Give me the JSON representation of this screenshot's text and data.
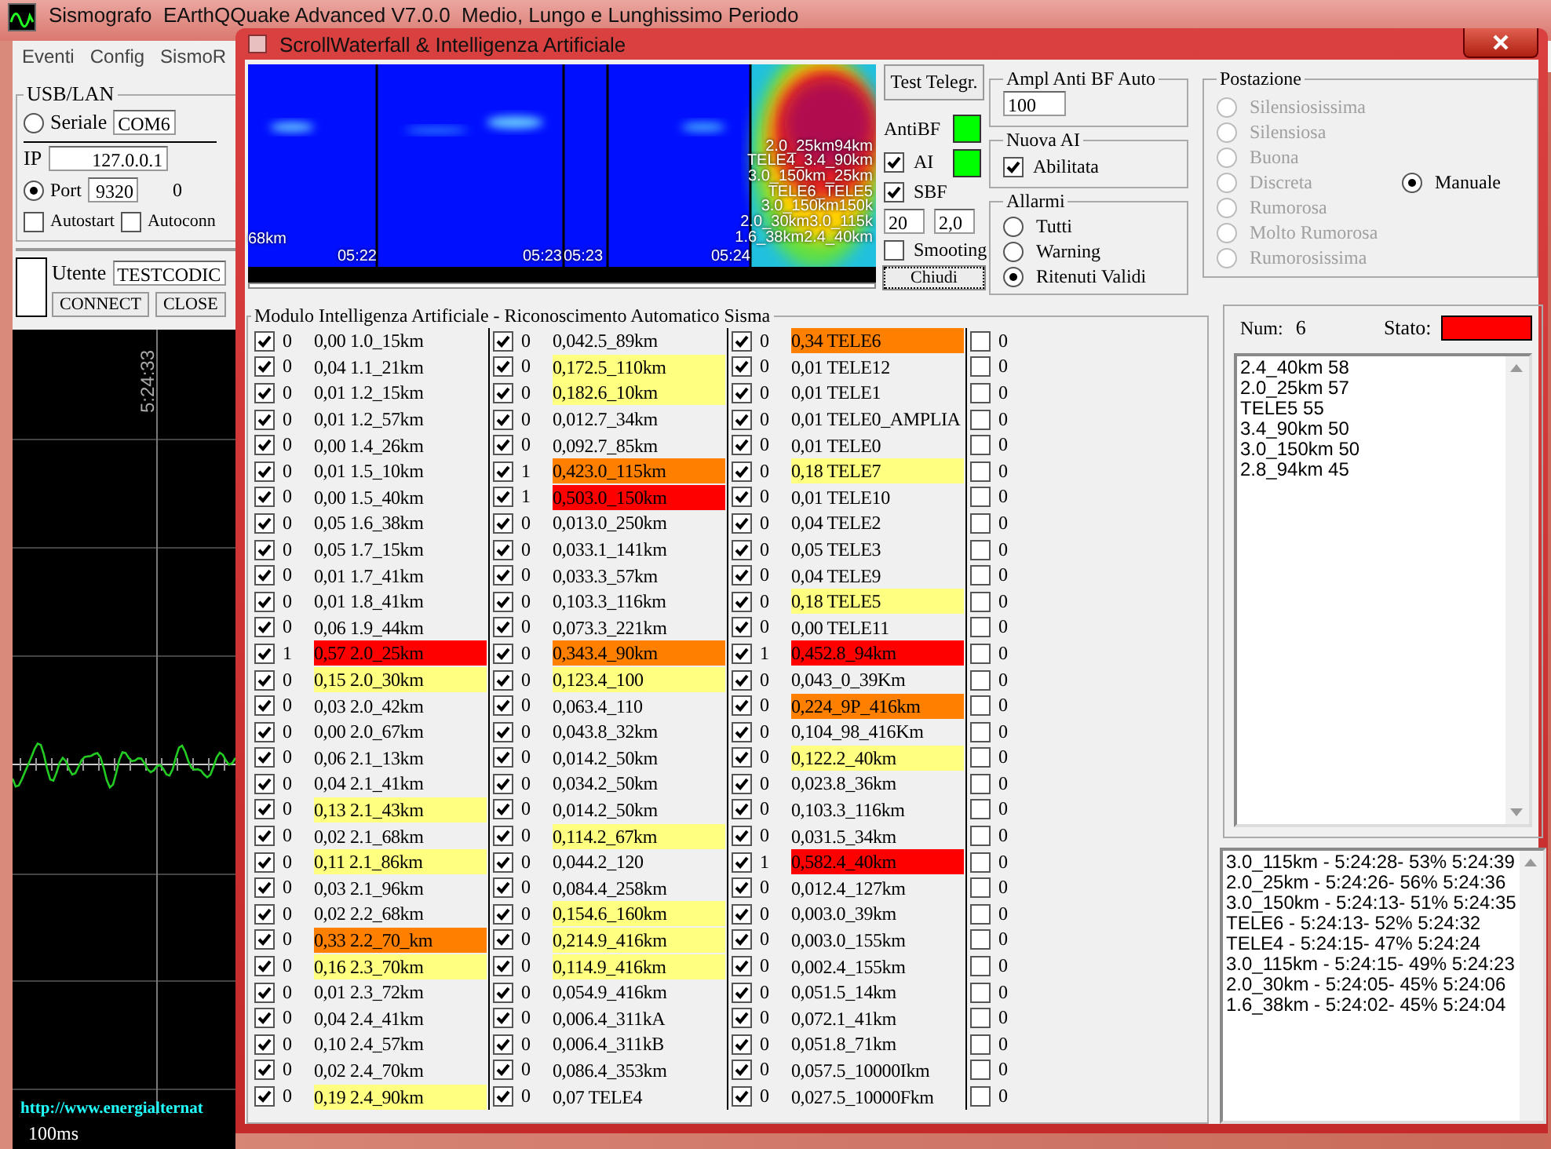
{
  "main_window": {
    "title": "Sismografo  EArthQQuake Advanced V7.0.0  Medio, Lungo e Lunghissimo Periodo",
    "menu": [
      "Eventi",
      "Config",
      "SismoR"
    ],
    "connection": {
      "title": "USB/LAN",
      "serial": {
        "label": "Seriale",
        "selected": false,
        "value": "COM6"
      },
      "ip": {
        "label": "IP",
        "value": "127.0.0.1"
      },
      "port": {
        "label": "Port",
        "selected": true,
        "value": "9320"
      },
      "port_status": "0",
      "autostart": {
        "label": "Autostart",
        "checked": false
      },
      "autoconn": {
        "label": "Autoconn",
        "checked": false
      }
    },
    "user": {
      "label": "Utente",
      "value": "TESTCODIC",
      "buttons": [
        "CONNECT",
        "CLOSE"
      ]
    },
    "scope": {
      "time": "5:24:33",
      "link": "http://www.energialternat",
      "scale": "100ms"
    }
  },
  "dialog": {
    "title": "ScrollWaterfall & Intelligenza Artificiale",
    "waterfall": {
      "distance": "68km",
      "times": [
        "05:22",
        "05:23",
        "05:23",
        "05:24"
      ],
      "labels": [
        "2.0_25km94km",
        "TELE4_3.4_90km",
        "3.0_150km_25km",
        "TELE6_TELE5",
        "3.0_150km150k",
        "2.0_30km3.0_115k",
        "1.6_38km2.4_40km"
      ]
    },
    "test_button": "Test Telegr.",
    "antibf": {
      "label": "AntiBF",
      "on": true
    },
    "ai": {
      "label": "AI",
      "checked": true,
      "on": true
    },
    "sbf": {
      "label": "SBF",
      "checked": true,
      "fields": [
        "20",
        "2,0"
      ]
    },
    "smoothing": {
      "label": "Smooting",
      "checked": false
    },
    "close_button": "Chiudi",
    "ampl": {
      "title": "Ampl Anti BF Auto",
      "value": "100"
    },
    "nuova_ai": {
      "title": "Nuova AI",
      "label": "Abilitata",
      "checked": true
    },
    "allarmi": {
      "title": "Allarmi",
      "options": [
        {
          "label": "Tutti",
          "selected": false
        },
        {
          "label": "Warning",
          "selected": false
        },
        {
          "label": "Ritenuti Validi",
          "selected": true
        }
      ]
    },
    "postazione": {
      "title": "Postazione",
      "options": [
        {
          "label": "Silensiosissima",
          "selected": false,
          "disabled": true
        },
        {
          "label": "Silensiosa",
          "selected": false,
          "disabled": true
        },
        {
          "label": "Buona",
          "selected": false,
          "disabled": true
        },
        {
          "label": "Discreta",
          "selected": false,
          "disabled": true
        },
        {
          "label": "Rumorosa",
          "selected": false,
          "disabled": true
        },
        {
          "label": "Molto Rumorosa",
          "selected": false,
          "disabled": true
        },
        {
          "label": "Rumorosissima",
          "selected": false,
          "disabled": true
        },
        {
          "label": "Manuale",
          "selected": true,
          "disabled": false
        }
      ]
    },
    "ai_module": {
      "title": "Modulo Intelligenza Artificiale - Riconoscimento Automatico Sisma",
      "columns": [
        {
          "rows": [
            {
              "checked": true,
              "count": "0",
              "label": "0,00 1.0_15km"
            },
            {
              "checked": true,
              "count": "0",
              "label": "0,04 1.1_21km"
            },
            {
              "checked": true,
              "count": "0",
              "label": "0,01 1.2_15km"
            },
            {
              "checked": true,
              "count": "0",
              "label": "0,01 1.2_57km"
            },
            {
              "checked": true,
              "count": "0",
              "label": "0,00 1.4_26km"
            },
            {
              "checked": true,
              "count": "0",
              "label": "0,01 1.5_10km"
            },
            {
              "checked": true,
              "count": "0",
              "label": "0,00 1.5_40km"
            },
            {
              "checked": true,
              "count": "0",
              "label": "0,05 1.6_38km"
            },
            {
              "checked": true,
              "count": "0",
              "label": "0,05 1.7_15km"
            },
            {
              "checked": true,
              "count": "0",
              "label": "0,01 1.7_41km"
            },
            {
              "checked": true,
              "count": "0",
              "label": "0,01 1.8_41km"
            },
            {
              "checked": true,
              "count": "0",
              "label": "0,06 1.9_44km"
            },
            {
              "checked": true,
              "count": "1",
              "label": "0,57 2.0_25km",
              "color": "#ff0000"
            },
            {
              "checked": true,
              "count": "0",
              "label": "0,15 2.0_30km",
              "color": "#ffff80"
            },
            {
              "checked": true,
              "count": "0",
              "label": "0,03 2.0_42km"
            },
            {
              "checked": true,
              "count": "0",
              "label": "0,00 2.0_67km"
            },
            {
              "checked": true,
              "count": "0",
              "label": "0,06 2.1_13km"
            },
            {
              "checked": true,
              "count": "0",
              "label": "0,04 2.1_41km"
            },
            {
              "checked": true,
              "count": "0",
              "label": "0,13 2.1_43km",
              "color": "#ffff80"
            },
            {
              "checked": true,
              "count": "0",
              "label": "0,02 2.1_68km"
            },
            {
              "checked": true,
              "count": "0",
              "label": "0,11 2.1_86km",
              "color": "#ffff80"
            },
            {
              "checked": true,
              "count": "0",
              "label": "0,03 2.1_96km"
            },
            {
              "checked": true,
              "count": "0",
              "label": "0,02 2.2_68km"
            },
            {
              "checked": true,
              "count": "0",
              "label": "0,33 2.2_70_km",
              "color": "#ff8000"
            },
            {
              "checked": true,
              "count": "0",
              "label": "0,16 2.3_70km",
              "color": "#ffff80"
            },
            {
              "checked": true,
              "count": "0",
              "label": "0,01 2.3_72km"
            },
            {
              "checked": true,
              "count": "0",
              "label": "0,04 2.4_41km"
            },
            {
              "checked": true,
              "count": "0",
              "label": "0,10 2.4_57km"
            },
            {
              "checked": true,
              "count": "0",
              "label": "0,02 2.4_70km"
            },
            {
              "checked": true,
              "count": "0",
              "label": "0,19 2.4_90km",
              "color": "#ffff80"
            }
          ]
        },
        {
          "rows": [
            {
              "checked": true,
              "count": "0",
              "label": "0,042.5_89km"
            },
            {
              "checked": true,
              "count": "0",
              "label": "0,172.5_110km",
              "color": "#ffff80"
            },
            {
              "checked": true,
              "count": "0",
              "label": "0,182.6_10km",
              "color": "#ffff80"
            },
            {
              "checked": true,
              "count": "0",
              "label": "0,012.7_34km"
            },
            {
              "checked": true,
              "count": "0",
              "label": "0,092.7_85km"
            },
            {
              "checked": true,
              "count": "1",
              "label": "0,423.0_115km",
              "color": "#ff8000"
            },
            {
              "checked": true,
              "count": "1",
              "label": "0,503.0_150km",
              "color": "#ff0000"
            },
            {
              "checked": true,
              "count": "0",
              "label": "0,013.0_250km"
            },
            {
              "checked": true,
              "count": "0",
              "label": "0,033.1_141km"
            },
            {
              "checked": true,
              "count": "0",
              "label": "0,033.3_57km"
            },
            {
              "checked": true,
              "count": "0",
              "label": "0,103.3_116km"
            },
            {
              "checked": true,
              "count": "0",
              "label": "0,073.3_221km"
            },
            {
              "checked": true,
              "count": "0",
              "label": "0,343.4_90km",
              "color": "#ff8000"
            },
            {
              "checked": true,
              "count": "0",
              "label": "0,123.4_100",
              "color": "#ffff80"
            },
            {
              "checked": true,
              "count": "0",
              "label": "0,063.4_110"
            },
            {
              "checked": true,
              "count": "0",
              "label": "0,043.8_32km"
            },
            {
              "checked": true,
              "count": "0",
              "label": "0,014.2_50km"
            },
            {
              "checked": true,
              "count": "0",
              "label": "0,034.2_50km"
            },
            {
              "checked": true,
              "count": "0",
              "label": "0,014.2_50km"
            },
            {
              "checked": true,
              "count": "0",
              "label": "0,114.2_67km",
              "color": "#ffff80"
            },
            {
              "checked": true,
              "count": "0",
              "label": "0,044.2_120"
            },
            {
              "checked": true,
              "count": "0",
              "label": "0,084.4_258km"
            },
            {
              "checked": true,
              "count": "0",
              "label": "0,154.6_160km",
              "color": "#ffff80"
            },
            {
              "checked": true,
              "count": "0",
              "label": "0,214.9_416km",
              "color": "#ffff80"
            },
            {
              "checked": true,
              "count": "0",
              "label": "0,114.9_416km",
              "color": "#ffff80"
            },
            {
              "checked": true,
              "count": "0",
              "label": "0,054.9_416km"
            },
            {
              "checked": true,
              "count": "0",
              "label": "0,006.4_311kA"
            },
            {
              "checked": true,
              "count": "0",
              "label": "0,006.4_311kB"
            },
            {
              "checked": true,
              "count": "0",
              "label": "0,086.4_353km"
            },
            {
              "checked": true,
              "count": "0",
              "label": "0,07 TELE4"
            }
          ]
        },
        {
          "rows": [
            {
              "checked": true,
              "count": "0",
              "label": "0,34 TELE6",
              "color": "#ff8000"
            },
            {
              "checked": true,
              "count": "0",
              "label": "0,01 TELE12"
            },
            {
              "checked": true,
              "count": "0",
              "label": "0,01 TELE1"
            },
            {
              "checked": true,
              "count": "0",
              "label": "0,01 TELE0_AMPLIA"
            },
            {
              "checked": true,
              "count": "0",
              "label": "0,01 TELE0"
            },
            {
              "checked": true,
              "count": "0",
              "label": "0,18 TELE7",
              "color": "#ffff80"
            },
            {
              "checked": true,
              "count": "0",
              "label": "0,01 TELE10"
            },
            {
              "checked": true,
              "count": "0",
              "label": "0,04 TELE2"
            },
            {
              "checked": true,
              "count": "0",
              "label": "0,05 TELE3"
            },
            {
              "checked": true,
              "count": "0",
              "label": "0,04 TELE9"
            },
            {
              "checked": true,
              "count": "0",
              "label": "0,18 TELE5",
              "color": "#ffff80"
            },
            {
              "checked": true,
              "count": "0",
              "label": "0,00 TELE11"
            },
            {
              "checked": true,
              "count": "1",
              "label": "0,452.8_94km",
              "color": "#ff0000"
            },
            {
              "checked": true,
              "count": "0",
              "label": "0,043_0_39Km"
            },
            {
              "checked": true,
              "count": "0",
              "label": "0,224_9P_416km",
              "color": "#ff8000"
            },
            {
              "checked": true,
              "count": "0",
              "label": "0,104_98_416Km"
            },
            {
              "checked": true,
              "count": "0",
              "label": "0,122.2_40km",
              "color": "#ffff80"
            },
            {
              "checked": true,
              "count": "0",
              "label": "0,023.8_36km"
            },
            {
              "checked": true,
              "count": "0",
              "label": "0,103.3_116km"
            },
            {
              "checked": true,
              "count": "0",
              "label": "0,031.5_34km"
            },
            {
              "checked": true,
              "count": "1",
              "label": "0,582.4_40km",
              "color": "#ff0000"
            },
            {
              "checked": true,
              "count": "0",
              "label": "0,012.4_127km"
            },
            {
              "checked": true,
              "count": "0",
              "label": "0,003.0_39km"
            },
            {
              "checked": true,
              "count": "0",
              "label": "0,003.0_155km"
            },
            {
              "checked": true,
              "count": "0",
              "label": "0,002.4_155km"
            },
            {
              "checked": true,
              "count": "0",
              "label": "0,051.5_14km"
            },
            {
              "checked": true,
              "count": "0",
              "label": "0,072.1_41km"
            },
            {
              "checked": true,
              "count": "0",
              "label": "0,051.8_71km"
            },
            {
              "checked": true,
              "count": "0",
              "label": "0,057.5_10000Ikm"
            },
            {
              "checked": true,
              "count": "0",
              "label": "0,027.5_10000Fkm"
            }
          ]
        },
        {
          "rows": [
            {
              "checked": false,
              "count": "0"
            },
            {
              "checked": false,
              "count": "0"
            },
            {
              "checked": false,
              "count": "0"
            },
            {
              "checked": false,
              "count": "0"
            },
            {
              "checked": false,
              "count": "0"
            },
            {
              "checked": false,
              "count": "0"
            },
            {
              "checked": false,
              "count": "0"
            },
            {
              "checked": false,
              "count": "0"
            },
            {
              "checked": false,
              "count": "0"
            },
            {
              "checked": false,
              "count": "0"
            },
            {
              "checked": false,
              "count": "0"
            },
            {
              "checked": false,
              "count": "0"
            },
            {
              "checked": false,
              "count": "0"
            },
            {
              "checked": false,
              "count": "0"
            },
            {
              "checked": false,
              "count": "0"
            },
            {
              "checked": false,
              "count": "0"
            },
            {
              "checked": false,
              "count": "0"
            },
            {
              "checked": false,
              "count": "0"
            },
            {
              "checked": false,
              "count": "0"
            },
            {
              "checked": false,
              "count": "0"
            },
            {
              "checked": false,
              "count": "0"
            },
            {
              "checked": false,
              "count": "0"
            },
            {
              "checked": false,
              "count": "0"
            },
            {
              "checked": false,
              "count": "0"
            },
            {
              "checked": false,
              "count": "0"
            },
            {
              "checked": false,
              "count": "0"
            },
            {
              "checked": false,
              "count": "0"
            },
            {
              "checked": false,
              "count": "0"
            },
            {
              "checked": false,
              "count": "0"
            },
            {
              "checked": false,
              "count": "0"
            }
          ]
        }
      ]
    },
    "results": {
      "num_label": "Num:",
      "num": "6",
      "stato": {
        "label": "Stato:",
        "color": "#ff0000"
      },
      "items": [
        "2.4_40km 58",
        "2.0_25km 57",
        "TELE5 55",
        "3.4_90km 50",
        "3.0_150km 50",
        "2.8_94km 45"
      ]
    },
    "log": [
      "3.0_115km - 5:24:28- 53% 5:24:39",
      "2.0_25km - 5:24:26- 56% 5:24:36",
      "3.0_150km - 5:24:13- 51% 5:24:35",
      "TELE6 - 5:24:13- 52% 5:24:32",
      "TELE4 - 5:24:15- 47% 5:24:24",
      "3.0_115km - 5:24:15- 49% 5:24:23",
      "2.0_30km - 5:24:05- 45% 5:24:06",
      "1.6_38km - 5:24:02- 45% 5:24:04"
    ]
  }
}
